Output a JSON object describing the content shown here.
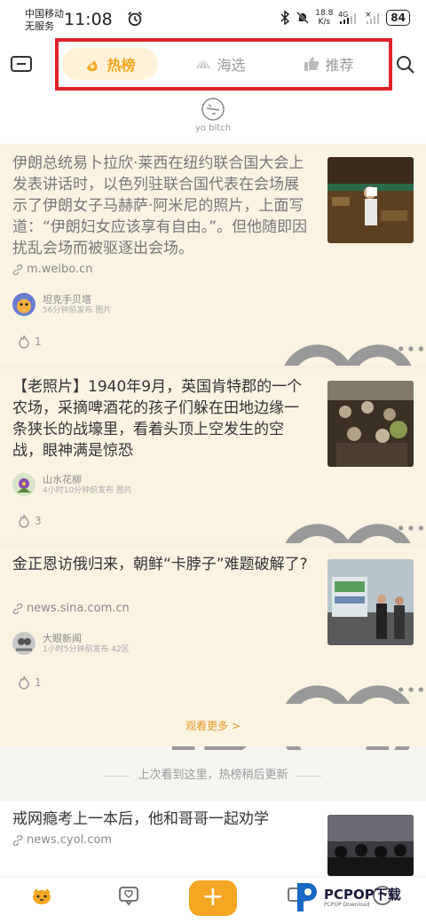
{
  "status_bar": {
    "carrier": "中国移动",
    "service": "无服务",
    "time": "11:08",
    "speed_value": "18.8",
    "speed_unit": "K/s",
    "network": "4G",
    "battery": "84"
  },
  "header": {
    "tabs": [
      {
        "label": "热榜",
        "icon": "fire-hand-icon"
      },
      {
        "label": "海选",
        "icon": "shell-icon"
      },
      {
        "label": "推荐",
        "icon": "thumbs-up-icon"
      }
    ],
    "yo_label": "yo bitch"
  },
  "feed": [
    {
      "title": "伊朗总统易卜拉欣·莱西在纽约联合国大会上发表讲话时，以色列驻联合国代表在会场展示了伊朗女子马赫萨·阿米尼的照片，上面写道：“伊朗妇女应该享有自由。”。但他随即因扰乱会场而被驱逐出会场。",
      "source": "m.weibo.cn",
      "author": "坦克手贝塔",
      "meta": "56分钟前发布  图片",
      "likes": "1"
    },
    {
      "title": "【老照片】1940年9月，英国肯特郡的一个农场，采摘啤酒花的孩子们躲在田地边缘一条狭长的战壕里，看着头顶上空发生的空战，眼神满是惊恐",
      "author": "山水花柳",
      "meta": "4小时10分钟前发布  图片",
      "likes": "3"
    },
    {
      "title": "金正恩访俄归来，朝鲜“卡脖子”难题破解了?",
      "source": "news.sina.com.cn",
      "author": "大眼新闻",
      "meta": "1小时5分钟前发布  42区",
      "likes": "1"
    }
  ],
  "more_link": "观看更多 >",
  "separator": "上次看到这里，热榜稍后更新",
  "next_item": {
    "title": "戒网瘾考上一本后，他和哥哥一起劝学",
    "source": "news.cyol.com"
  },
  "watermark": {
    "title": "PCPOP下载",
    "subtitle": "PCPOP Download"
  },
  "colors": {
    "accent": "#f5a623",
    "highlight": "#e0222a",
    "card_bg": "#faf3e2"
  }
}
